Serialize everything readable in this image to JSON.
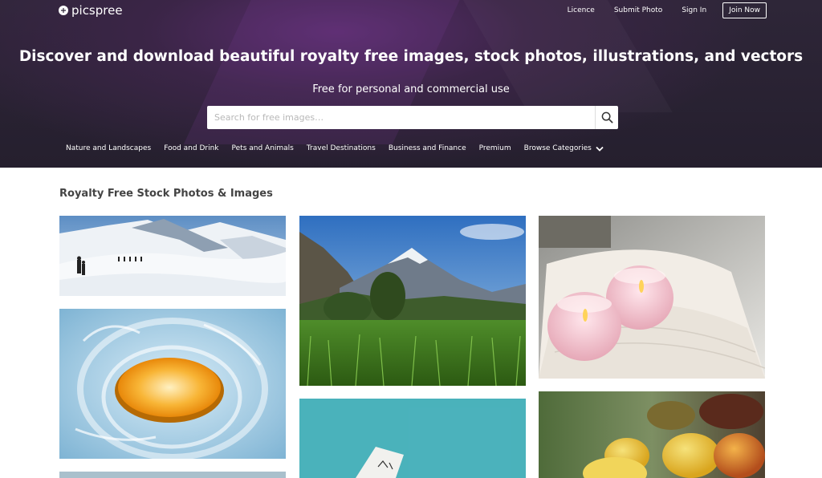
{
  "brand": {
    "name": "picspree"
  },
  "topnav": {
    "licence": "Licence",
    "submit_photo": "Submit Photo",
    "sign_in": "Sign In",
    "join_now": "Join Now"
  },
  "hero": {
    "headline": "Discover and download beautiful royalty free images, stock photos, illustrations, and vectors",
    "subline": "Free for personal and commercial use"
  },
  "search": {
    "placeholder": "Search for free images…"
  },
  "categories": [
    "Nature and Landscapes",
    "Food and Drink",
    "Pets and Animals",
    "Travel Destinations",
    "Business and Finance",
    "Premium",
    "Browse Categories"
  ],
  "main": {
    "section_title": "Royalty Free Stock Photos & Images"
  },
  "photos": [
    {
      "subject": "snowy mountain hikers"
    },
    {
      "subject": "orange slice splash in water"
    },
    {
      "subject": "mountain landscape meadow"
    },
    {
      "subject": "turquoise surface with paper"
    },
    {
      "subject": "candles on towels"
    },
    {
      "subject": "fruit bowl"
    }
  ]
}
